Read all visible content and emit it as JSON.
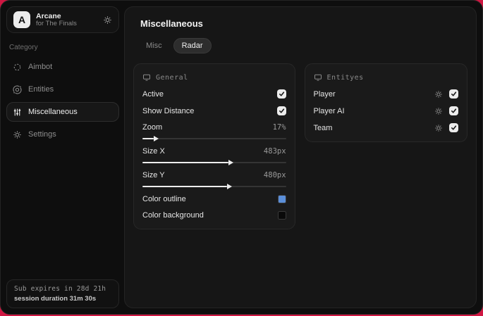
{
  "app": {
    "name": "Arcane",
    "subtitle": "for The Finals",
    "logo_letter": "A"
  },
  "sidebar": {
    "category_label": "Category",
    "items": [
      {
        "label": "Aimbot",
        "icon": "crosshair-icon",
        "active": false
      },
      {
        "label": "Entities",
        "icon": "orbit-icon",
        "active": false
      },
      {
        "label": "Miscellaneous",
        "icon": "sliders-icon",
        "active": true
      },
      {
        "label": "Settings",
        "icon": "gear-icon",
        "active": false
      }
    ],
    "footer": {
      "line1": "Sub expires in 28d 21h",
      "line2": "session duration 31m 30s"
    }
  },
  "main": {
    "title": "Miscellaneous",
    "tabs": [
      {
        "label": "Misc",
        "active": false
      },
      {
        "label": "Radar",
        "active": true
      }
    ],
    "general": {
      "header": "General",
      "toggles": [
        {
          "label": "Active",
          "checked": true
        },
        {
          "label": "Show Distance",
          "checked": true
        }
      ],
      "sliders": [
        {
          "label": "Zoom",
          "value": "17%",
          "fill_pct": 8
        },
        {
          "label": "Size X",
          "value": "483px",
          "fill_pct": 60
        },
        {
          "label": "Size Y",
          "value": "480px",
          "fill_pct": 59
        }
      ],
      "colors": [
        {
          "label": "Color outline",
          "hex": "#5b8fd9"
        },
        {
          "label": "Color background",
          "hex": "#0a0a0a"
        }
      ]
    },
    "entities": {
      "header": "Entityes",
      "rows": [
        {
          "label": "Player",
          "checked": true
        },
        {
          "label": "Player AI",
          "checked": true
        },
        {
          "label": "Team",
          "checked": true
        }
      ]
    }
  },
  "colors": {
    "accent_blue": "#5b8fd9",
    "page_background": "#cf1742"
  }
}
